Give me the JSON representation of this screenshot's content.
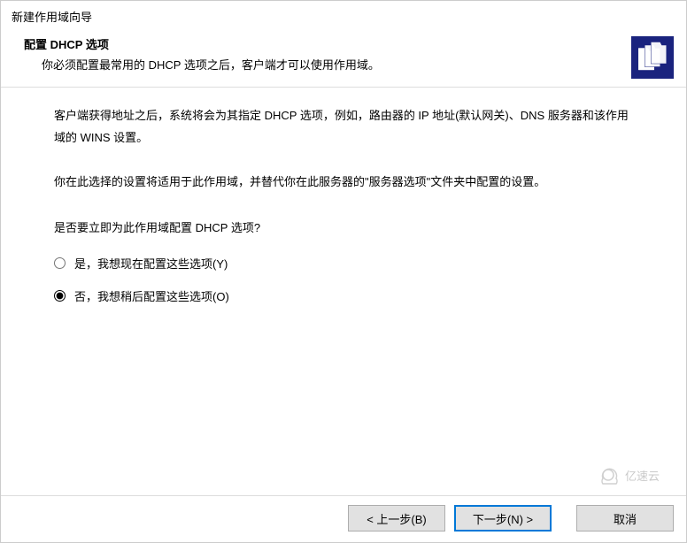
{
  "wizard": {
    "title": "新建作用域向导",
    "section_title": "配置 DHCP 选项",
    "section_subtitle": "你必须配置最常用的 DHCP 选项之后，客户端才可以使用作用域。"
  },
  "content": {
    "para1": "客户端获得地址之后，系统将会为其指定 DHCP 选项，例如，路由器的 IP 地址(默认网关)、DNS 服务器和该作用域的 WINS 设置。",
    "para2": "你在此选择的设置将适用于此作用域，并替代你在此服务器的\"服务器选项\"文件夹中配置的设置。",
    "question": "是否要立即为此作用域配置 DHCP 选项?"
  },
  "options": {
    "yes_label": "是，我想现在配置这些选项(Y)",
    "no_label": "否，我想稍后配置这些选项(O)",
    "selected": "no"
  },
  "buttons": {
    "back": "< 上一步(B)",
    "next": "下一步(N) >",
    "cancel": "取消"
  },
  "watermark": {
    "text": "亿速云"
  }
}
